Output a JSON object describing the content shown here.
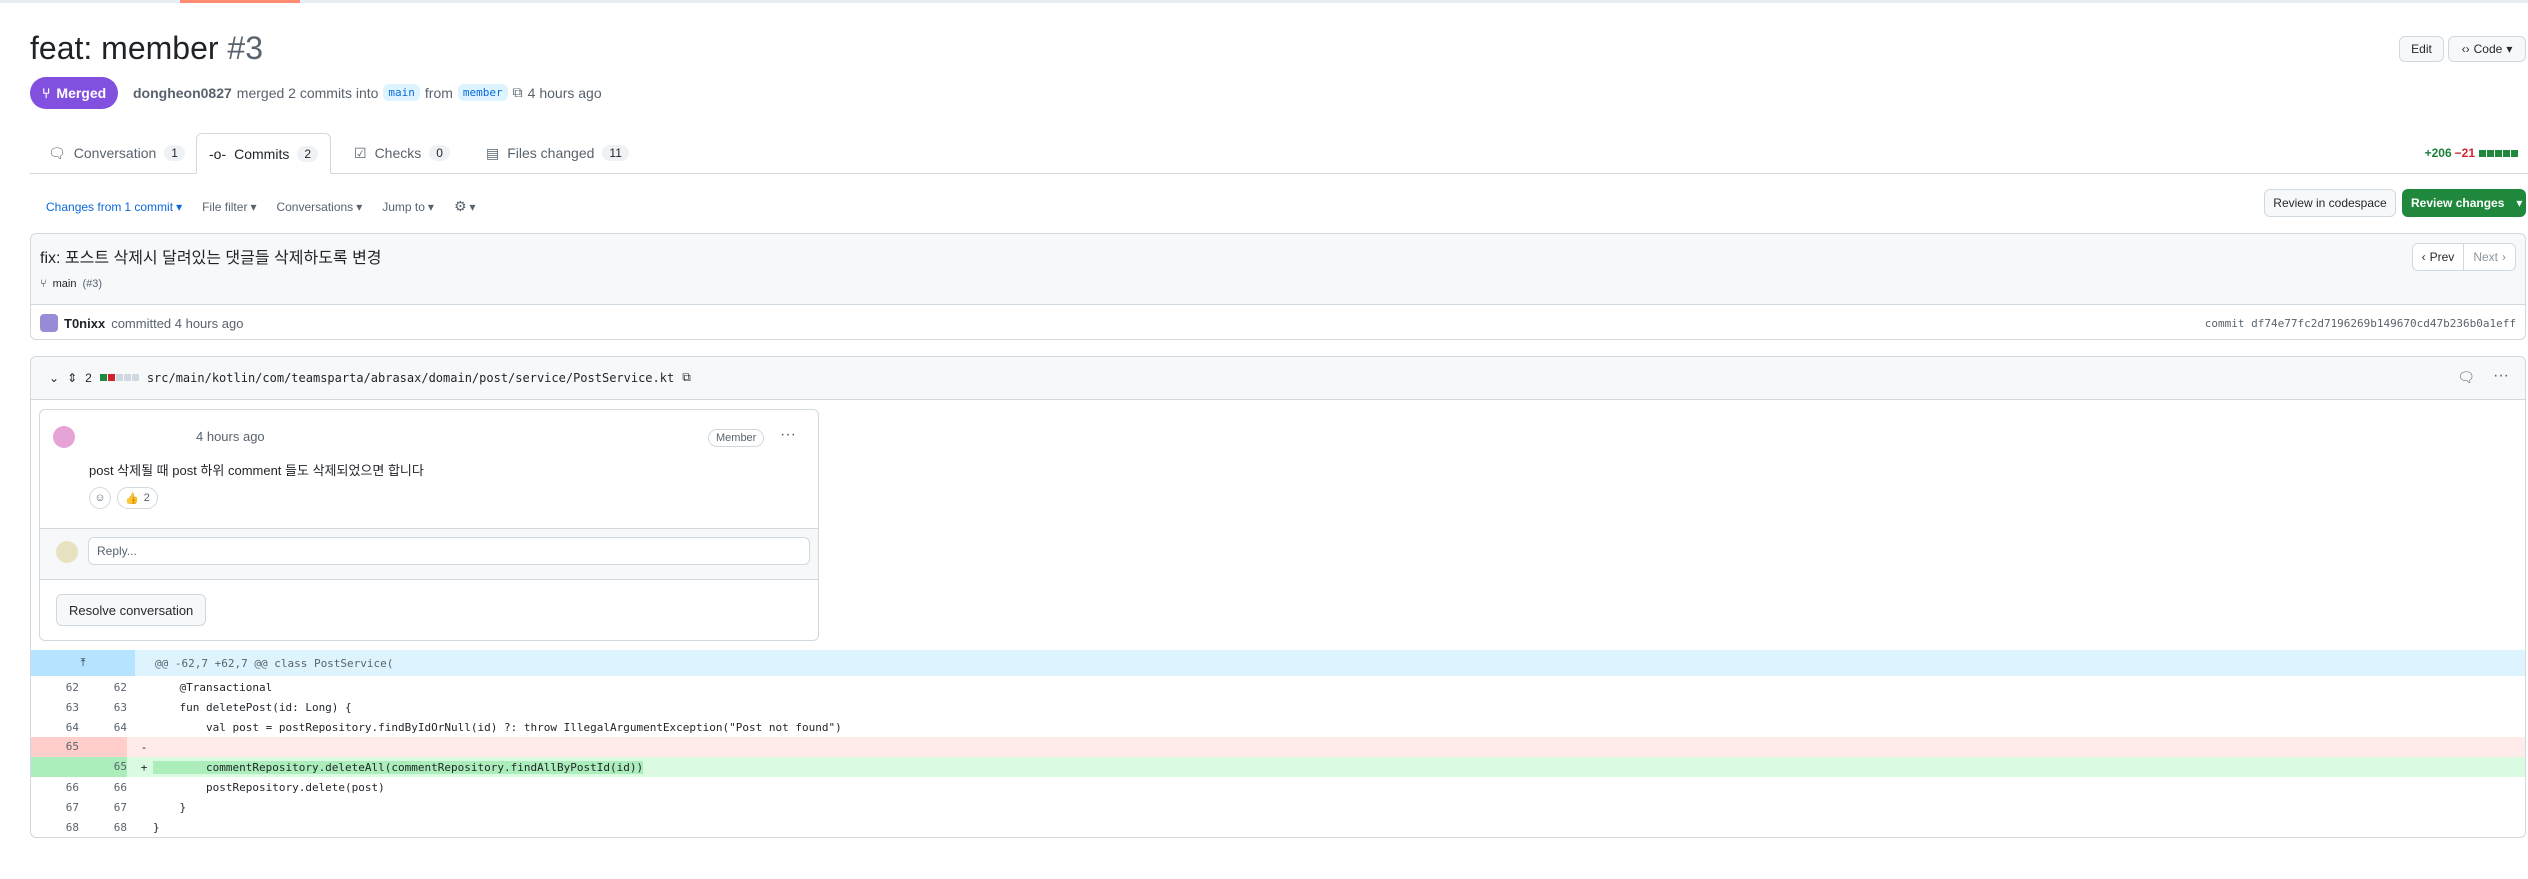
{
  "pr": {
    "title": "feat: member",
    "number": "#3",
    "state": "Merged",
    "author": "dongheon0827",
    "merged_text": "merged 2 commits into",
    "base_branch": "main",
    "from_text": "from",
    "head_branch": "member",
    "time": "4 hours ago",
    "edit_label": "Edit",
    "code_label": "Code"
  },
  "tabs": [
    {
      "label": "Conversation",
      "count": "1"
    },
    {
      "label": "Commits",
      "count": "2"
    },
    {
      "label": "Checks",
      "count": "0"
    },
    {
      "label": "Files changed",
      "count": "11"
    }
  ],
  "diffstat": {
    "additions": "+206",
    "deletions": "−21"
  },
  "toolbar": {
    "changes_from": "Changes from",
    "changes_commit": "1 commit",
    "file_filter": "File filter",
    "conversations": "Conversations",
    "jump_to": "Jump to",
    "review_codespace": "Review in codespace",
    "review_changes": "Review changes"
  },
  "commit": {
    "title": "fix: 포스트 삭제시 달려있는 댓글들 삭제하도록 변경",
    "branch": "main",
    "pr_ref": "(#3)",
    "prev": "Prev",
    "next": "Next",
    "committer": "T0nixx",
    "committed_text": "committed 4 hours ago",
    "sha_label": "commit",
    "sha": "df74e77fc2d7196269b149670cd47b236b0a1eff"
  },
  "file": {
    "changes_count": "2",
    "path": "src/main/kotlin/com/teamsparta/abrasax/domain/post/service/PostService.kt"
  },
  "thread": {
    "time": "4 hours ago",
    "role_badge": "Member",
    "body": "post 삭제될 때 post 하위 comment 들도 삭제되었으면 합니다",
    "thumbs_count": "2",
    "reply_placeholder": "Reply...",
    "resolve_label": "Resolve conversation"
  },
  "diff": {
    "hunk_header": "@@ -62,7 +62,7 @@ class PostService(",
    "lines": [
      {
        "old": "62",
        "new": "62",
        "sign": "",
        "text": "    @Transactional"
      },
      {
        "old": "63",
        "new": "63",
        "sign": "",
        "text": "    fun deletePost(id: Long) {"
      },
      {
        "old": "64",
        "new": "64",
        "sign": "",
        "text": "        val post = postRepository.findByIdOrNull(id) ?: throw IllegalArgumentException(\"Post not found\")"
      },
      {
        "old": "65",
        "new": "",
        "sign": "-",
        "text": ""
      },
      {
        "old": "",
        "new": "65",
        "sign": "+",
        "text": "        commentRepository.deleteAll(commentRepository.findAllByPostId(id))"
      },
      {
        "old": "66",
        "new": "66",
        "sign": "",
        "text": "        postRepository.delete(post)"
      },
      {
        "old": "67",
        "new": "67",
        "sign": "",
        "text": "    }"
      },
      {
        "old": "68",
        "new": "68",
        "sign": "",
        "text": "}"
      }
    ]
  },
  "colors": {
    "merged": "#8250df",
    "green_button": "#1f883d",
    "deletion_bg": "#ffebe9",
    "addition_bg": "#dafbe1",
    "hunk_bg": "#ddf4ff"
  }
}
